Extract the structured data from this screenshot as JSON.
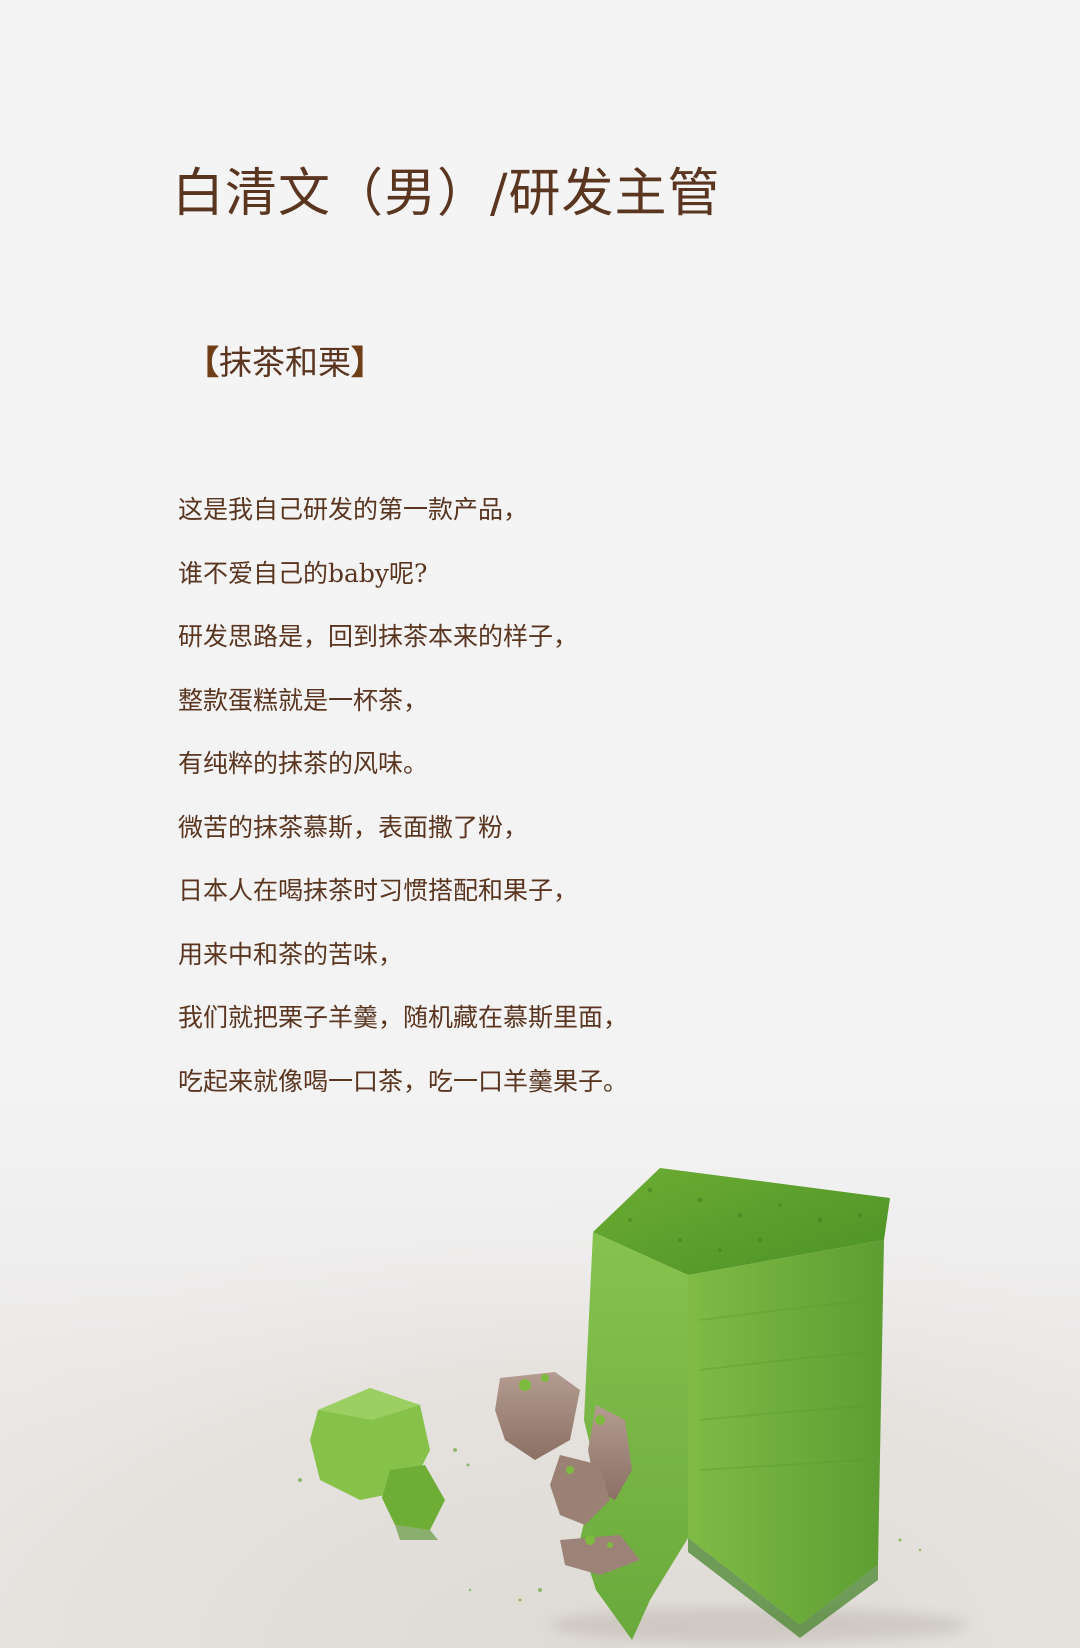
{
  "header": {
    "title": "白清文（男）/研发主管"
  },
  "product": {
    "bracket_left": "【",
    "name": "抹茶和栗",
    "bracket_right": "】"
  },
  "description": {
    "lines": [
      "这是我自己研发的第一款产品，",
      "谁不爱自己的baby呢?",
      "研发思路是，回到抹茶本来的样子，",
      "整款蛋糕就是一杯茶，",
      "有纯粹的抹茶的风味。",
      "微苦的抹茶慕斯，表面撒了粉，",
      "日本人在喝抹茶时习惯搭配和果子，",
      "用来中和茶的苦味，",
      "我们就把栗子羊羹，随机藏在慕斯里面，",
      "吃起来就像喝一口茶，吃一口羊羹果子。"
    ]
  },
  "colors": {
    "background": "#f4f3f4",
    "text": "#5a351f",
    "matcha_light": "#7cbd3e",
    "matcha_dark": "#4e8f27",
    "chestnut": "#a48a7e"
  },
  "image": {
    "subject": "matcha-chestnut-cake-photo"
  }
}
